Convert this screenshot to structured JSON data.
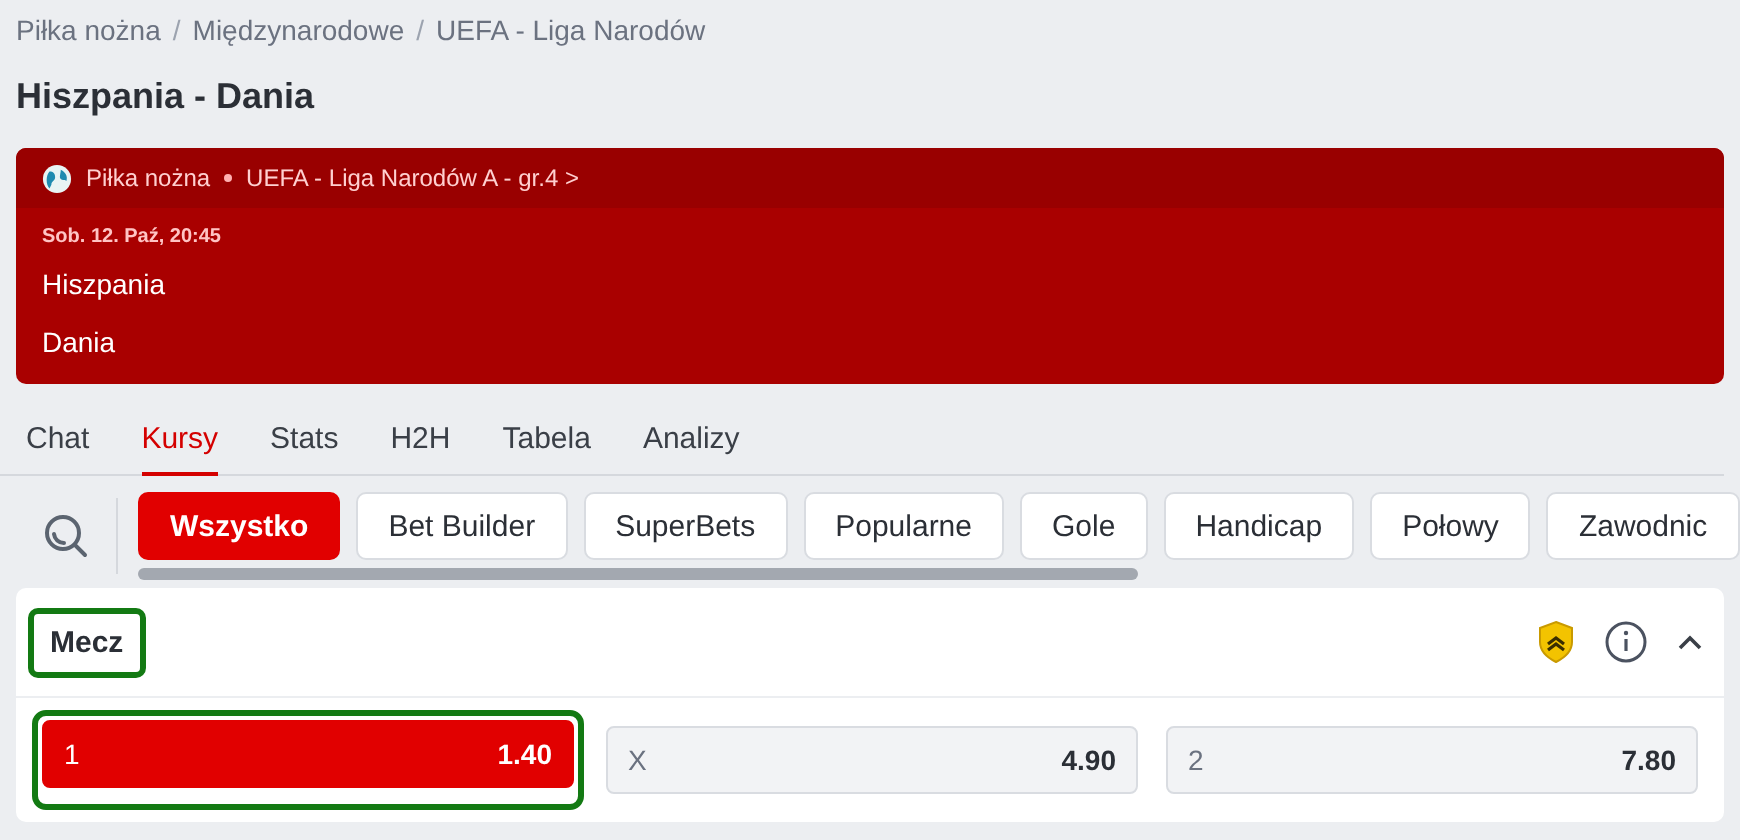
{
  "breadcrumb": {
    "separator": "/",
    "items": [
      "Piłka nożna",
      "Międzynarodowe",
      "UEFA - Liga Narodów"
    ]
  },
  "title": "Hiszpania - Dania",
  "event": {
    "sport": "Piłka nożna",
    "competition": "UEFA - Liga Narodów A - gr.4",
    "chevron": ">",
    "datetime": "Sob. 12. Paź, 20:45",
    "teams": [
      "Hiszpania",
      "Dania"
    ]
  },
  "tabs": [
    {
      "label": "Chat",
      "selected": false
    },
    {
      "label": "Kursy",
      "selected": true
    },
    {
      "label": "Stats",
      "selected": false
    },
    {
      "label": "H2H",
      "selected": false
    },
    {
      "label": "Tabela",
      "selected": false
    },
    {
      "label": "Analizy",
      "selected": false
    }
  ],
  "filters": [
    {
      "label": "Wszystko",
      "selected": true
    },
    {
      "label": "Bet Builder",
      "selected": false
    },
    {
      "label": "SuperBets",
      "selected": false
    },
    {
      "label": "Popularne",
      "selected": false
    },
    {
      "label": "Gole",
      "selected": false
    },
    {
      "label": "Handicap",
      "selected": false
    },
    {
      "label": "Połowy",
      "selected": false
    },
    {
      "label": "Zawodnic",
      "selected": false
    }
  ],
  "market": {
    "title": "Mecz",
    "highlighted": true,
    "expanded": true,
    "odds": [
      {
        "label": "1",
        "value": "1.40",
        "selected": true,
        "highlighted": true
      },
      {
        "label": "X",
        "value": "4.90",
        "selected": false,
        "highlighted": false
      },
      {
        "label": "2",
        "value": "7.80",
        "selected": false,
        "highlighted": false
      }
    ]
  }
}
